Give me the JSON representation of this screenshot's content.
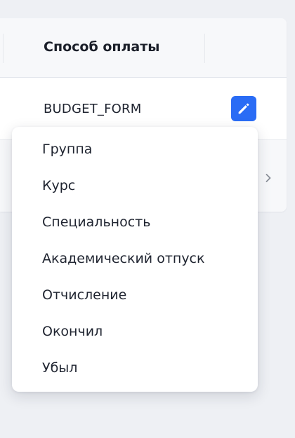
{
  "table": {
    "column_header": "Способ оплаты",
    "row": {
      "payment_method": "BUDGET_FORM"
    }
  },
  "icons": {
    "edit": "pencil-icon",
    "next": "chevron-right-icon"
  },
  "colors": {
    "accent": "#2a6cf5",
    "background": "#eef0f4",
    "header_bg": "#f7f8fa"
  },
  "menu": {
    "items": [
      {
        "label": "Группа"
      },
      {
        "label": "Курс"
      },
      {
        "label": "Специальность"
      },
      {
        "label": "Академический отпуск"
      },
      {
        "label": "Отчисление"
      },
      {
        "label": "Окончил"
      },
      {
        "label": "Убыл"
      }
    ]
  }
}
